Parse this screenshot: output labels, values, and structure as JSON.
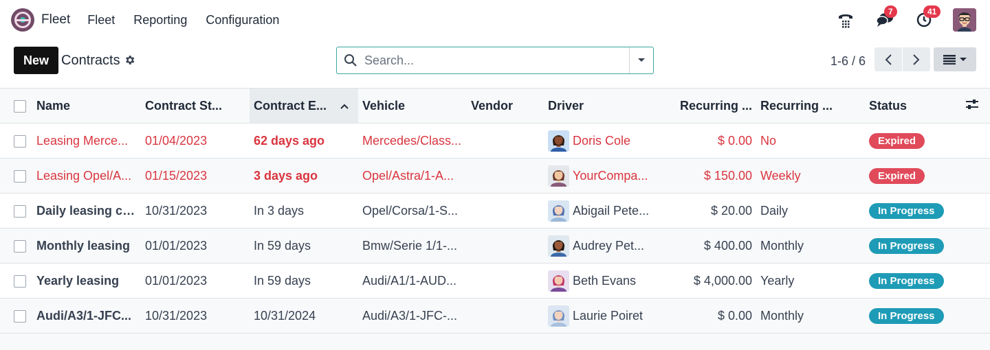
{
  "nav": {
    "app_name": "Fleet",
    "menu": [
      "Fleet",
      "Reporting",
      "Configuration"
    ],
    "messages_count": "7",
    "activities_count": "41"
  },
  "control": {
    "new_label": "New",
    "breadcrumb": "Contracts",
    "search_placeholder": "Search...",
    "pager": "1-6 / 6"
  },
  "colors": {
    "accent": "#714b67",
    "danger": "#d9353f",
    "expired": "#e04a5a",
    "in_progress": "#1e9bb6"
  },
  "table": {
    "headers": [
      "Name",
      "Contract St...",
      "Contract E...",
      "Vehicle",
      "Vendor",
      "Driver",
      "Recurring ...",
      "Recurring ...",
      "Status"
    ],
    "rows": [
      {
        "name": "Leasing Merce...",
        "start": "01/04/2023",
        "end": "62 days ago",
        "vehicle": "Mercedes/Class...",
        "vendor": "",
        "driver": "Doris Cole",
        "cost": "$ 0.00",
        "freq": "No",
        "status": "Expired",
        "danger": true,
        "end_bold": true
      },
      {
        "name": "Leasing Opel/A...",
        "start": "01/15/2023",
        "end": "3 days ago",
        "vehicle": "Opel/Astra/1-A...",
        "vendor": "",
        "driver": "YourCompa...",
        "cost": "$ 150.00",
        "freq": "Weekly",
        "status": "Expired",
        "danger": true,
        "end_bold": true
      },
      {
        "name": "Daily leasing co...",
        "start": "10/31/2023",
        "end": "In 3 days",
        "vehicle": "Opel/Corsa/1-S...",
        "vendor": "",
        "driver": "Abigail Pete...",
        "cost": "$ 20.00",
        "freq": "Daily",
        "status": "In Progress",
        "danger": false,
        "end_bold": false
      },
      {
        "name": "Monthly leasing",
        "start": "01/01/2023",
        "end": "In 59 days",
        "vehicle": "Bmw/Serie 1/1-...",
        "vendor": "",
        "driver": "Audrey Pet...",
        "cost": "$ 400.00",
        "freq": "Monthly",
        "status": "In Progress",
        "danger": false,
        "end_bold": false
      },
      {
        "name": "Yearly leasing",
        "start": "01/01/2023",
        "end": "In 59 days",
        "vehicle": "Audi/A1/1-AUD...",
        "vendor": "",
        "driver": "Beth Evans",
        "cost": "$ 4,000.00",
        "freq": "Yearly",
        "status": "In Progress",
        "danger": false,
        "end_bold": false
      },
      {
        "name": "Audi/A3/1-JFC...",
        "start": "10/31/2023",
        "end": "10/31/2024",
        "vehicle": "Audi/A3/1-JFC-...",
        "vendor": "",
        "driver": "Laurie Poiret",
        "cost": "$ 0.00",
        "freq": "Monthly",
        "status": "In Progress",
        "danger": false,
        "end_bold": false
      }
    ]
  }
}
